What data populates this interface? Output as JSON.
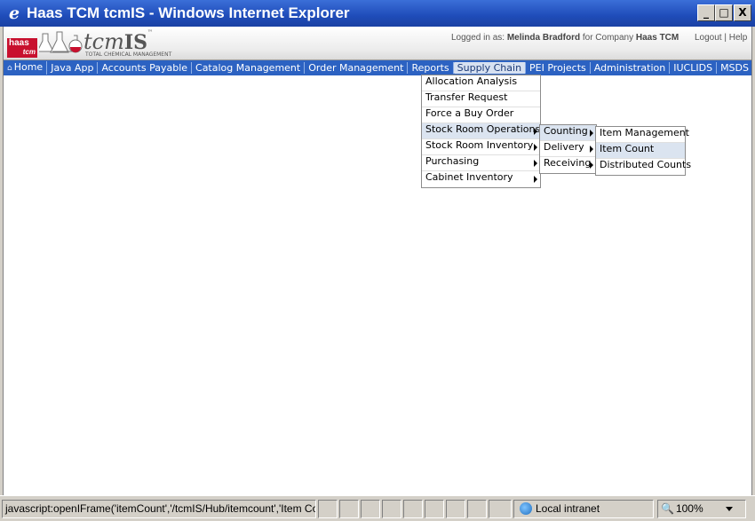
{
  "window": {
    "title": "Haas TCM tcmIS - Windows Internet Explorer",
    "controls": {
      "minimize": "_",
      "maximize": "□",
      "close": "X"
    }
  },
  "header": {
    "logo": {
      "top": "haas",
      "bottom": "tcm"
    },
    "brand": "tcmIS",
    "brand_prefix": "tcm",
    "brand_suffix": "IS",
    "tm": "™",
    "tagline": "TOTAL CHEMICAL MANAGEMENT",
    "login_prefix": "Logged in as:",
    "user": "Melinda Bradford",
    "company_prefix": "for Company",
    "company": "Haas TCM",
    "logout": "Logout",
    "separator": "|",
    "help": "Help"
  },
  "nav": {
    "items": [
      {
        "label": "Home",
        "icon": "home-icon"
      },
      {
        "label": "Java App"
      },
      {
        "label": "Accounts Payable"
      },
      {
        "label": "Catalog Management"
      },
      {
        "label": "Order Management"
      },
      {
        "label": "Reports"
      },
      {
        "label": "Supply Chain",
        "active": true
      },
      {
        "label": "PEI Projects"
      },
      {
        "label": "Administration"
      },
      {
        "label": "IUCLIDS"
      },
      {
        "label": "MSDS"
      }
    ]
  },
  "supply_chain_menu": {
    "items": [
      {
        "label": "Allocation Analysis"
      },
      {
        "label": "Transfer Request"
      },
      {
        "label": "Force a Buy Order"
      },
      {
        "label": "Stock Room Operations",
        "submenu": true,
        "highlighted": true
      },
      {
        "label": "Stock Room Inventory",
        "submenu": true
      },
      {
        "label": "Purchasing",
        "submenu": true
      },
      {
        "label": "Cabinet Inventory",
        "submenu": true
      }
    ]
  },
  "stock_room_menu": {
    "items": [
      {
        "label": "Counting",
        "submenu": true,
        "highlighted": true
      },
      {
        "label": "Delivery",
        "submenu": true
      },
      {
        "label": "Receiving",
        "submenu": true
      }
    ]
  },
  "counting_menu": {
    "items": [
      {
        "label": "Item Management"
      },
      {
        "label": "Item Count",
        "highlighted": true
      },
      {
        "label": "Distributed Counts"
      }
    ]
  },
  "statusbar": {
    "text": "javascript:openIFrame('itemCount','/tcmIS/Hub/itemcount','Item Count','','N')",
    "zone": "Local intranet",
    "zoom": "100%"
  },
  "colors": {
    "titlebar": "#1f4cb9",
    "navbar": "#2c62c2",
    "menu_highlight": "#dbe4f0",
    "logo_red": "#c8102e"
  }
}
